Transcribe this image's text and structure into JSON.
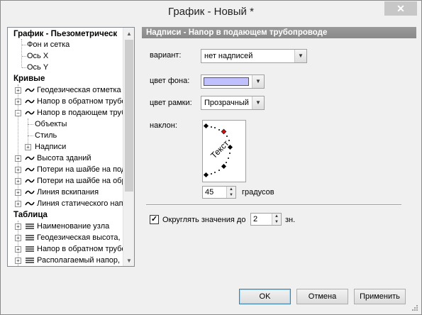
{
  "window": {
    "title": "График - Новый *",
    "close_glyph": "✕"
  },
  "tree": {
    "rows": [
      {
        "label": "График - Пьезометрическ",
        "bold": true
      },
      {
        "label": "Фон и сетка"
      },
      {
        "label": "Ось X"
      },
      {
        "label": "Ось Y"
      },
      {
        "label": "Кривые",
        "bold": true
      },
      {
        "label": "Геодезическая отметка"
      },
      {
        "label": "Напор в обратном трубо"
      },
      {
        "label": "Напор в подающем труб"
      },
      {
        "label": "Объекты"
      },
      {
        "label": "Стиль"
      },
      {
        "label": "Надписи"
      },
      {
        "label": "Высота зданий"
      },
      {
        "label": "Потери на шайбе на под"
      },
      {
        "label": "Потери на шайбе на обр"
      },
      {
        "label": "Линия вскипания"
      },
      {
        "label": "Линия статического нап"
      },
      {
        "label": "Таблица",
        "bold": true
      },
      {
        "label": "Наименование узла"
      },
      {
        "label": "Геодезическая высота,"
      },
      {
        "label": "Напор в обратном трубо"
      },
      {
        "label": "Располагаемый напор,"
      }
    ]
  },
  "panel": {
    "header": "Надписи - Напор в подающем трубопроводе",
    "variant_label": "вариант:",
    "variant_value": "нет надписей",
    "bg_color_label": "цвет фона:",
    "bg_color": "#c0c0ff",
    "frame_color_label": "цвет рамки:",
    "frame_color_value": "Прозрачный",
    "tilt_label": "наклон:",
    "preview_text": "Текст",
    "angle_value": "45",
    "angle_unit": "градусов",
    "round_label": "Округлять значения до",
    "round_checked": true,
    "round_value": "2",
    "round_unit": "зн."
  },
  "buttons": {
    "ok": "OK",
    "cancel": "Отмена",
    "apply": "Применить"
  }
}
